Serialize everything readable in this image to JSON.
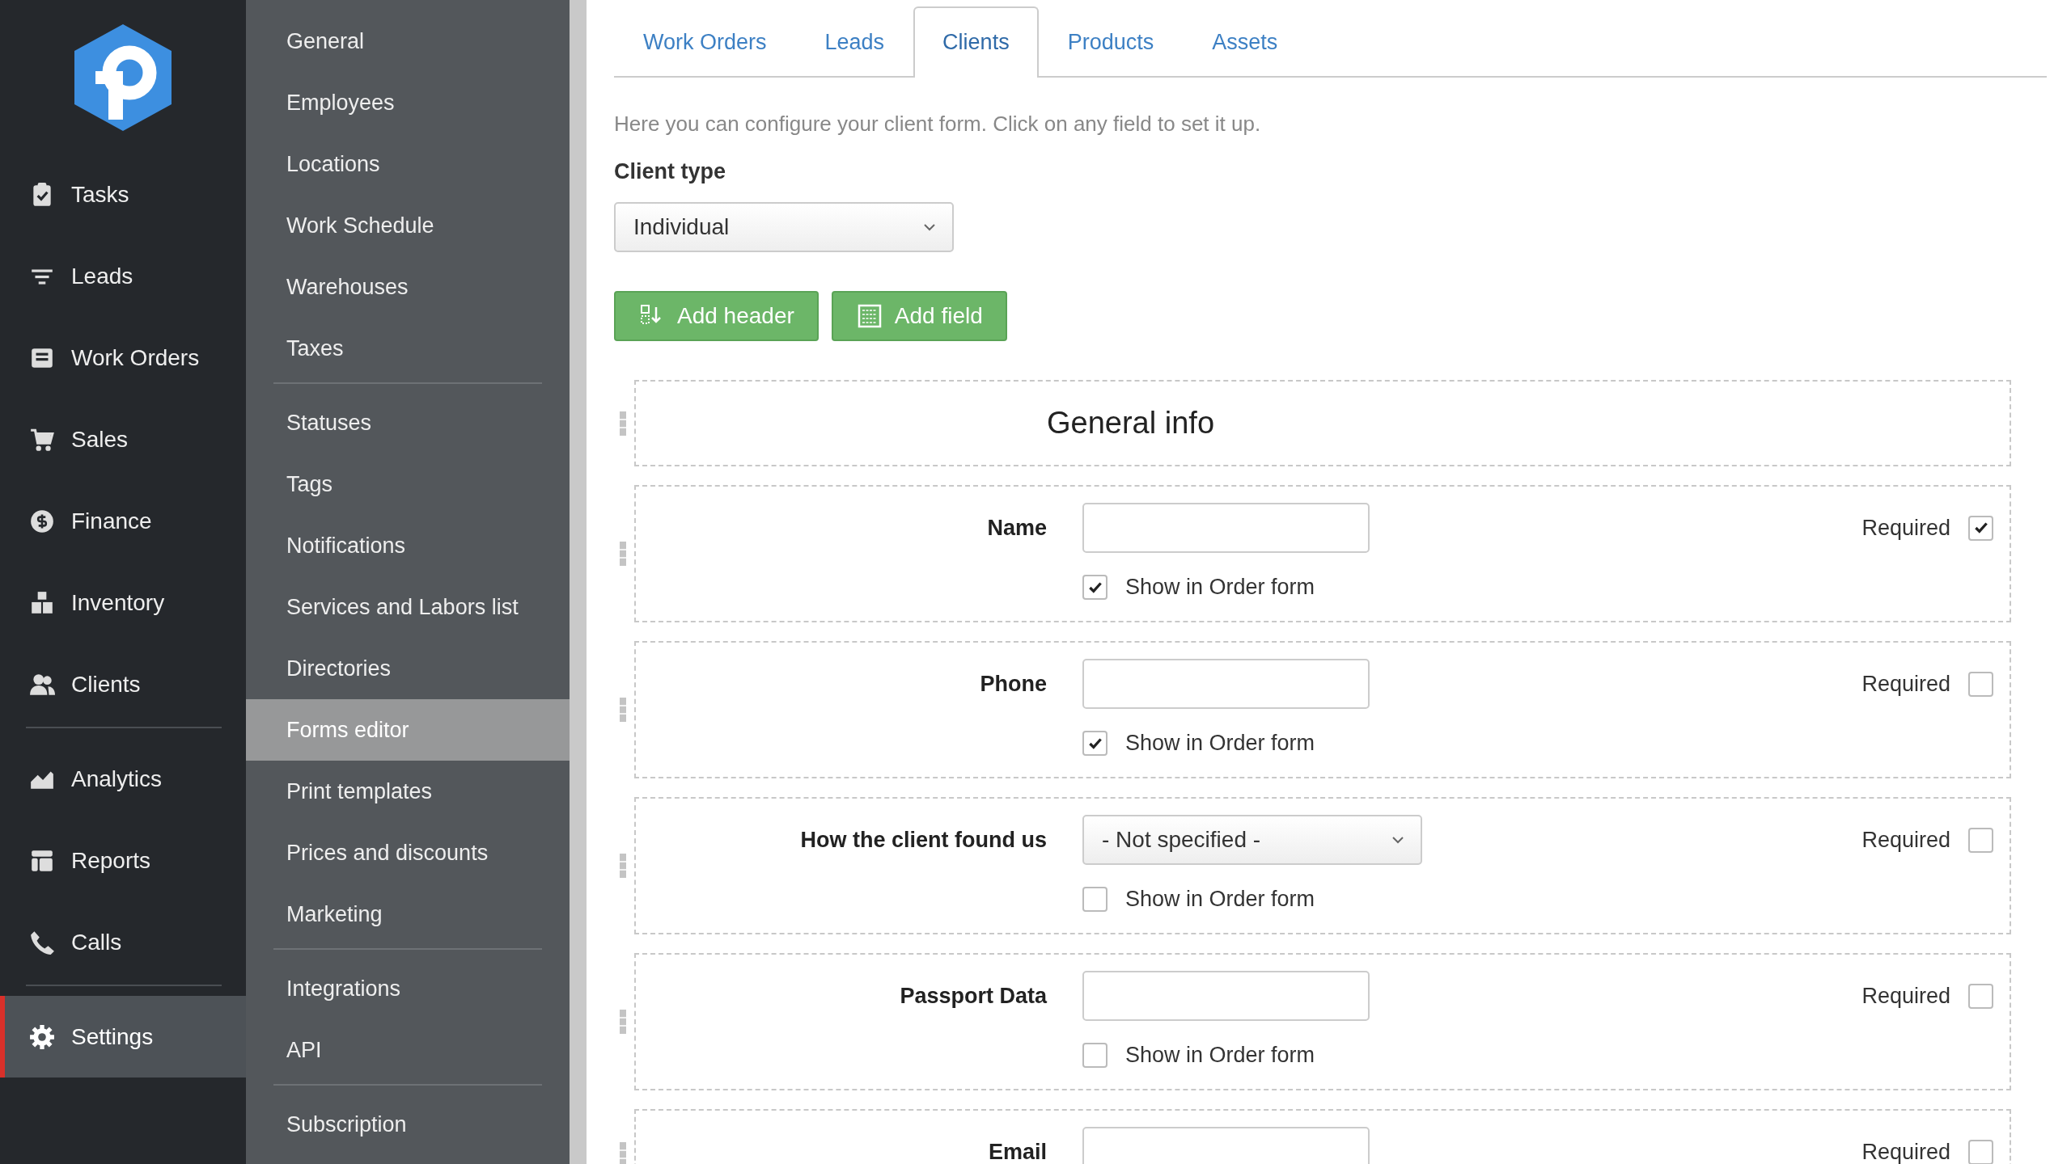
{
  "nav": {
    "groups": [
      [
        {
          "label": "Tasks",
          "selected": false
        },
        {
          "label": "Leads",
          "selected": false
        },
        {
          "label": "Work Orders",
          "selected": false
        },
        {
          "label": "Sales",
          "selected": false
        },
        {
          "label": "Finance",
          "selected": false
        },
        {
          "label": "Inventory",
          "selected": false
        },
        {
          "label": "Clients",
          "selected": false
        }
      ],
      [
        {
          "label": "Analytics",
          "selected": false
        },
        {
          "label": "Reports",
          "selected": false
        },
        {
          "label": "Calls",
          "selected": false
        }
      ],
      [
        {
          "label": "Settings",
          "selected": true
        }
      ]
    ]
  },
  "settings_menu": {
    "groups": [
      [
        {
          "label": "General",
          "selected": false
        },
        {
          "label": "Employees",
          "selected": false
        },
        {
          "label": "Locations",
          "selected": false
        },
        {
          "label": "Work Schedule",
          "selected": false
        },
        {
          "label": "Warehouses",
          "selected": false
        },
        {
          "label": "Taxes",
          "selected": false
        }
      ],
      [
        {
          "label": "Statuses",
          "selected": false
        },
        {
          "label": "Tags",
          "selected": false
        },
        {
          "label": "Notifications",
          "selected": false
        },
        {
          "label": "Services and Labors list",
          "selected": false
        },
        {
          "label": "Directories",
          "selected": false
        },
        {
          "label": "Forms editor",
          "selected": true
        },
        {
          "label": "Print templates",
          "selected": false
        },
        {
          "label": "Prices and discounts",
          "selected": false
        },
        {
          "label": "Marketing",
          "selected": false
        }
      ],
      [
        {
          "label": "Integrations",
          "selected": false
        },
        {
          "label": "API",
          "selected": false
        }
      ],
      [
        {
          "label": "Subscription",
          "selected": false
        }
      ]
    ]
  },
  "tabs": [
    {
      "label": "Work Orders",
      "selected": false
    },
    {
      "label": "Leads",
      "selected": false
    },
    {
      "label": "Clients",
      "selected": true
    },
    {
      "label": "Products",
      "selected": false
    },
    {
      "label": "Assets",
      "selected": false
    }
  ],
  "description": "Here you can configure your client form. Click on any field to set it up.",
  "client_type": {
    "label": "Client type",
    "value": "Individual"
  },
  "buttons": [
    {
      "label": "Add header"
    },
    {
      "label": "Add field"
    }
  ],
  "form": {
    "header": "General info",
    "fields": [
      {
        "label": "Name",
        "kind": "input",
        "required_label": "Required",
        "required": true,
        "order_form": {
          "label": "Show in Order form",
          "checked": true
        }
      },
      {
        "label": "Phone",
        "kind": "input",
        "required_label": "Required",
        "required": false,
        "order_form": {
          "label": "Show in Order form",
          "checked": true
        }
      },
      {
        "label": "How the client found us",
        "kind": "select",
        "value": "- Not specified -",
        "required_label": "Required",
        "required": false,
        "order_form": {
          "label": "Show in Order form",
          "checked": false
        }
      },
      {
        "label": "Passport Data",
        "kind": "input",
        "required_label": "Required",
        "required": false,
        "order_form": {
          "label": "Show in Order form",
          "checked": false
        }
      },
      {
        "label": "Email",
        "kind": "input",
        "required_label": "Required",
        "required": false
      }
    ]
  }
}
